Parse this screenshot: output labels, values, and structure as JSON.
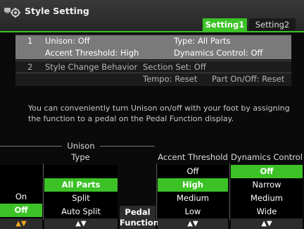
{
  "window": {
    "title": "Style Setting",
    "icon": "style-setting-icon"
  },
  "tabs": [
    {
      "label": "Setting1",
      "selected": true
    },
    {
      "label": "Setting2",
      "selected": false
    }
  ],
  "table": {
    "row1": {
      "number": "1",
      "unison": "Unison: Off",
      "type": "Type: All Parts",
      "accent_threshold": "Accent Threshold: High",
      "dynamics_control": "Dynamics Control: Off"
    },
    "row2": {
      "number": "2",
      "style_change_behavior": "Style Change Behavior",
      "section_set": "Section Set: Off",
      "tempo": "Tempo: Reset",
      "part_on_off": "Part On/Off: Reset"
    }
  },
  "description": "You can conveniently turn Unison on/off with your foot by assigning the function to a pedal on the Pedal Function display.",
  "controls": {
    "unison_group_label": "Unison",
    "onoff": {
      "options": [
        "On",
        "Off"
      ],
      "selected": "Off",
      "footer": "▲▼"
    },
    "type": {
      "header": "Type",
      "options": [
        "All Parts",
        "Split",
        "Auto Split"
      ],
      "selected": "All Parts",
      "footer": "▲▼"
    },
    "pedal_function": {
      "label_line1": "Pedal",
      "label_line2": "Function"
    },
    "accent_threshold": {
      "header": "Accent Threshold",
      "options": [
        "Off",
        "High",
        "Medium",
        "Low"
      ],
      "selected": "High",
      "footer": "▲▼"
    },
    "dynamics_control": {
      "header": "Dynamics Control",
      "options": [
        "Off",
        "Narrow",
        "Medium",
        "Wide"
      ],
      "selected": "Off",
      "footer": "▲▼"
    }
  },
  "colors": {
    "accent": "#3cc227",
    "highlight_arrow": "#f6a81e"
  }
}
